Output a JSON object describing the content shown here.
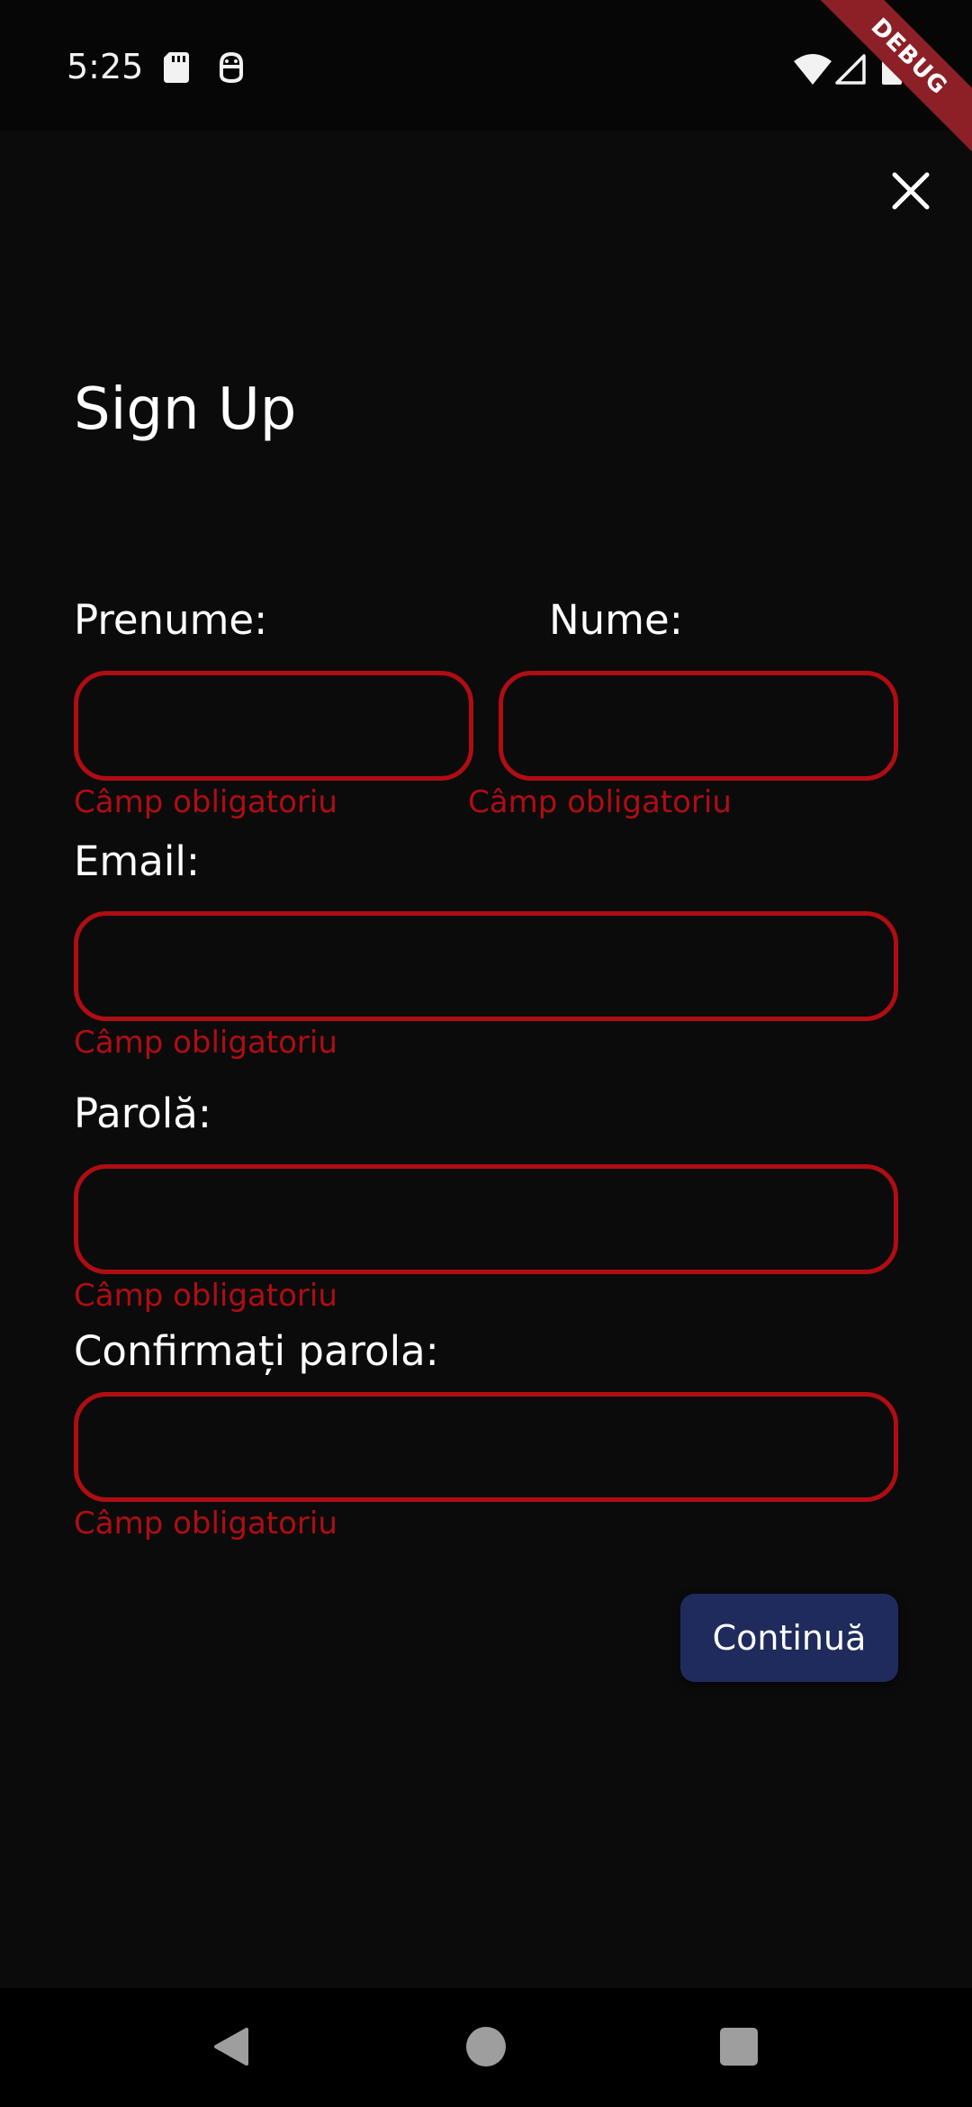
{
  "status_bar": {
    "time": "5:25",
    "debug_label": "DEBUG",
    "icons": [
      "sd-card-icon",
      "android-debug-icon",
      "wifi-icon",
      "signal-icon",
      "battery-icon"
    ]
  },
  "header": {
    "close_icon": "close-icon"
  },
  "form": {
    "title": "Sign Up",
    "first_name": {
      "label": "Prenume:",
      "value": "",
      "error": "Câmp obligatoriu"
    },
    "last_name": {
      "label": "Nume:",
      "value": "",
      "error": "Câmp obligatoriu"
    },
    "email": {
      "label": "Email:",
      "value": "",
      "error": "Câmp obligatoriu"
    },
    "password": {
      "label": "Parolă:",
      "value": "",
      "error": "Câmp obligatoriu"
    },
    "confirm_password": {
      "label": "Confirmați parola:",
      "value": "",
      "error": "Câmp obligatoriu"
    },
    "continue_label": "Continuă"
  },
  "colors": {
    "background": "#0b0b0c",
    "error": "#b00d12",
    "button": "#1e2b5c",
    "debug_ribbon": "#8d1f26"
  },
  "nav_bar": {
    "icons": [
      "back-icon",
      "home-icon",
      "recents-icon"
    ]
  }
}
